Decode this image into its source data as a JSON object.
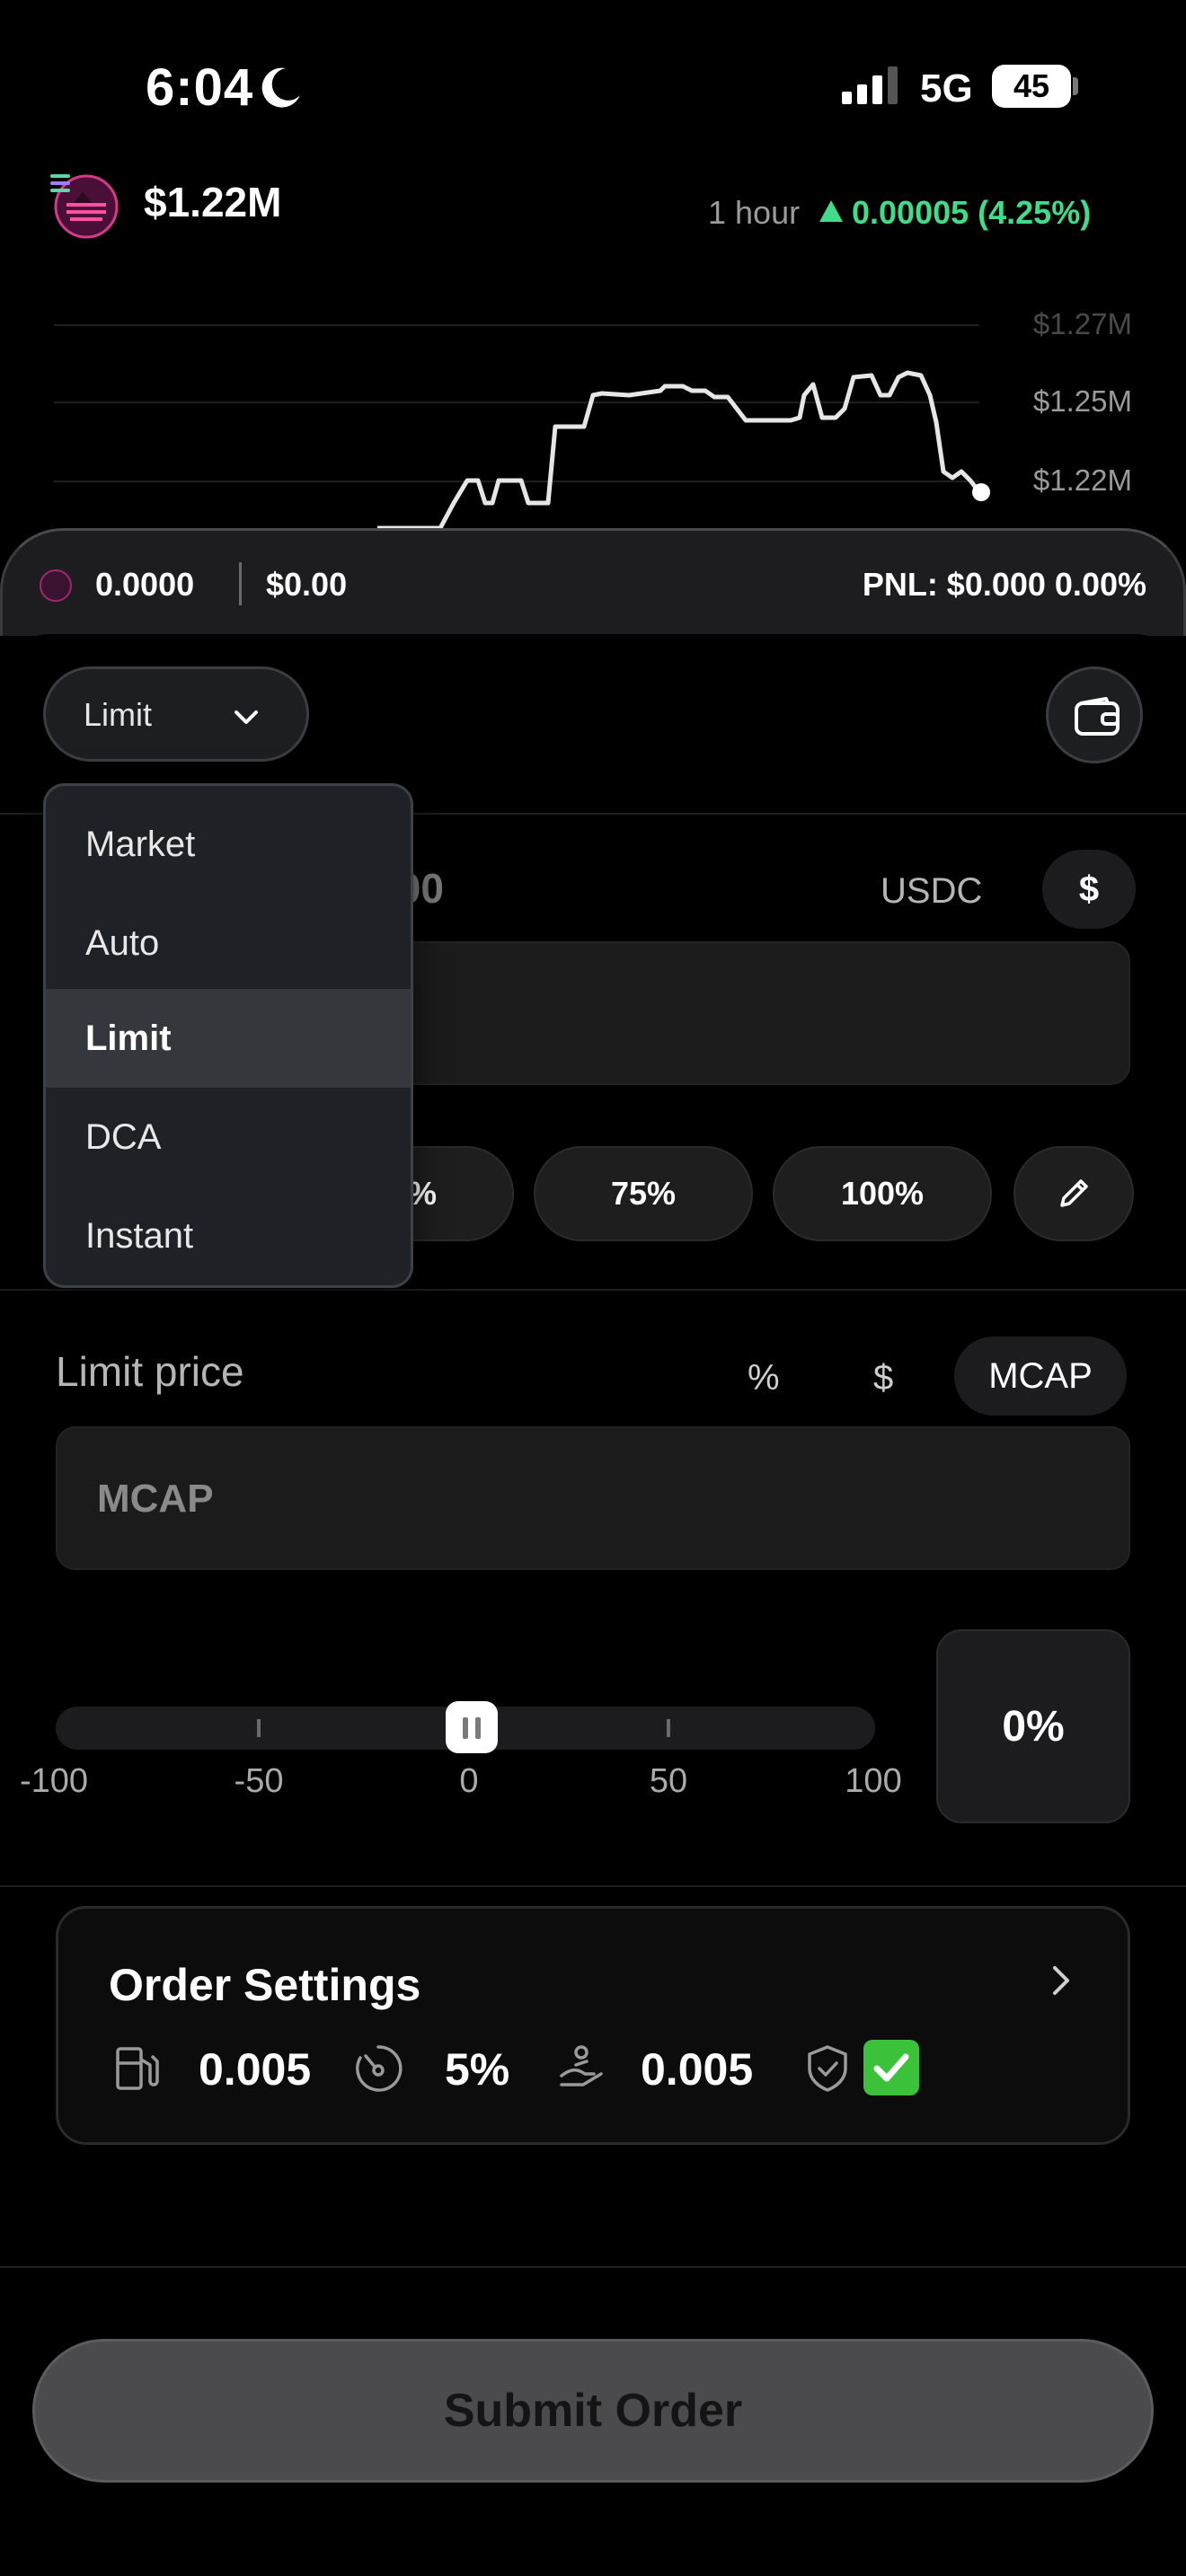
{
  "status_bar": {
    "time": "6:04",
    "network": "5G",
    "battery": "45"
  },
  "token": {
    "mcap": "$1.22M",
    "timeframe": "1 hour",
    "change": "0.00005 (4.25%)"
  },
  "chart": {
    "y_ticks": [
      "$1.27M",
      "$1.25M",
      "$1.22M"
    ]
  },
  "position": {
    "amount": "0.0000",
    "value": "$0.00",
    "pnl": "PNL: $0.000 0.00%"
  },
  "order_type": {
    "selected": "Limit",
    "options": [
      "Market",
      "Auto",
      "Limit",
      "DCA",
      "Instant"
    ]
  },
  "amount": {
    "value": ".00",
    "currency": "USDC",
    "toggle": "$"
  },
  "percent_buttons": [
    "%",
    "75%",
    "100%"
  ],
  "limit": {
    "label": "Limit price",
    "units": [
      "%",
      "$",
      "MCAP"
    ],
    "placeholder": "MCAP"
  },
  "slider": {
    "labels": [
      "-100",
      "-50",
      "0",
      "50",
      "100"
    ],
    "value": "0%"
  },
  "order_settings": {
    "title": "Order Settings",
    "gas": "0.005",
    "slippage": "5%",
    "tip": "0.005"
  },
  "submit_label": "Submit Order",
  "colors": {
    "accent_green": "#3fdc8a",
    "check_green": "#3cc13b"
  }
}
